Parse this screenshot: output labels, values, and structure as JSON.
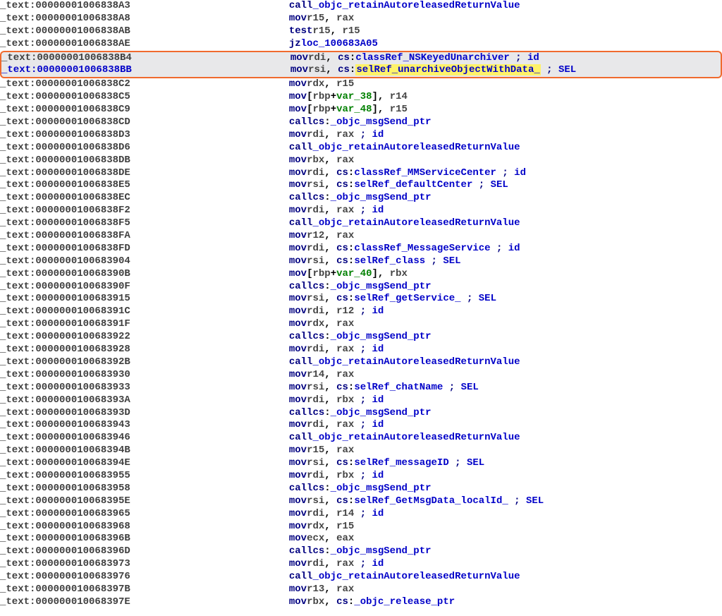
{
  "rows": [
    {
      "addr": "_text:00000001006838A3",
      "mnem": "call",
      "ops": [
        {
          "t": "id",
          "v": "_objc_retainAutoreleasedReturnValue"
        }
      ]
    },
    {
      "addr": "_text:00000001006838A8",
      "mnem": "mov",
      "ops": [
        {
          "t": "reg",
          "v": "r15"
        },
        {
          "t": "comma"
        },
        {
          "t": "reg",
          "v": "rax"
        }
      ]
    },
    {
      "addr": "_text:00000001006838AB",
      "mnem": "test",
      "ops": [
        {
          "t": "reg",
          "v": "r15"
        },
        {
          "t": "comma"
        },
        {
          "t": "reg",
          "v": "r15"
        }
      ]
    },
    {
      "addr": "_text:00000001006838AE",
      "mnem": "jz",
      "ops": [
        {
          "t": "id",
          "v": "loc_100683A05"
        }
      ]
    },
    {
      "addr": "_text:00000001006838B4",
      "mnem": "mov",
      "boxed": "top",
      "ops": [
        {
          "t": "reg",
          "v": "rdi"
        },
        {
          "t": "comma"
        },
        {
          "t": "kw",
          "v": "cs"
        },
        {
          "t": "txt",
          "v": ":"
        },
        {
          "t": "id",
          "v": "classRef_NSKeyedUnarchiver"
        },
        {
          "t": "sp"
        },
        {
          "t": "kw",
          "v": ";"
        },
        {
          "t": "sp"
        },
        {
          "t": "id",
          "v": "id"
        }
      ]
    },
    {
      "addr": "_text:00000001006838BB",
      "mnem": "mov",
      "current": true,
      "boxed": "bot",
      "ops": [
        {
          "t": "reg",
          "v": "rsi"
        },
        {
          "t": "comma"
        },
        {
          "t": "kw",
          "v": "cs"
        },
        {
          "t": "txt",
          "v": ":"
        },
        {
          "t": "hl",
          "v": "selRef_unarchiveObjectWithData_"
        },
        {
          "t": "sp"
        },
        {
          "t": "sp"
        },
        {
          "t": "kw",
          "v": ";"
        },
        {
          "t": "sp"
        },
        {
          "t": "id",
          "v": "SEL"
        }
      ]
    },
    {
      "addr": "_text:00000001006838C2",
      "mnem": "mov",
      "ops": [
        {
          "t": "reg",
          "v": "rdx"
        },
        {
          "t": "comma"
        },
        {
          "t": "reg",
          "v": "r15"
        }
      ]
    },
    {
      "addr": "_text:00000001006838C5",
      "mnem": "mov",
      "ops": [
        {
          "t": "txt",
          "v": "["
        },
        {
          "t": "reg",
          "v": "rbp"
        },
        {
          "t": "txt",
          "v": "+"
        },
        {
          "t": "var",
          "v": "var_38"
        },
        {
          "t": "txt",
          "v": "]"
        },
        {
          "t": "comma"
        },
        {
          "t": "reg",
          "v": "r14"
        }
      ]
    },
    {
      "addr": "_text:00000001006838C9",
      "mnem": "mov",
      "ops": [
        {
          "t": "txt",
          "v": "["
        },
        {
          "t": "reg",
          "v": "rbp"
        },
        {
          "t": "txt",
          "v": "+"
        },
        {
          "t": "var",
          "v": "var_48"
        },
        {
          "t": "txt",
          "v": "]"
        },
        {
          "t": "comma"
        },
        {
          "t": "reg",
          "v": "r15"
        }
      ]
    },
    {
      "addr": "_text:00000001006838CD",
      "mnem": "call",
      "ops": [
        {
          "t": "kw",
          "v": "cs"
        },
        {
          "t": "txt",
          "v": ":"
        },
        {
          "t": "id",
          "v": "_objc_msgSend_ptr"
        }
      ]
    },
    {
      "addr": "_text:00000001006838D3",
      "mnem": "mov",
      "ops": [
        {
          "t": "reg",
          "v": "rdi"
        },
        {
          "t": "comma"
        },
        {
          "t": "reg",
          "v": "rax"
        },
        {
          "t": "pad"
        },
        {
          "t": "kw",
          "v": ";"
        },
        {
          "t": "sp"
        },
        {
          "t": "id",
          "v": "id"
        }
      ]
    },
    {
      "addr": "_text:00000001006838D6",
      "mnem": "call",
      "ops": [
        {
          "t": "id",
          "v": "_objc_retainAutoreleasedReturnValue"
        }
      ]
    },
    {
      "addr": "_text:00000001006838DB",
      "mnem": "mov",
      "ops": [
        {
          "t": "reg",
          "v": "rbx"
        },
        {
          "t": "comma"
        },
        {
          "t": "reg",
          "v": "rax"
        }
      ]
    },
    {
      "addr": "_text:00000001006838DE",
      "mnem": "mov",
      "ops": [
        {
          "t": "reg",
          "v": "rdi"
        },
        {
          "t": "comma"
        },
        {
          "t": "kw",
          "v": "cs"
        },
        {
          "t": "txt",
          "v": ":"
        },
        {
          "t": "id",
          "v": "classRef_MMServiceCenter"
        },
        {
          "t": "sp"
        },
        {
          "t": "kw",
          "v": ";"
        },
        {
          "t": "sp"
        },
        {
          "t": "id",
          "v": "id"
        }
      ]
    },
    {
      "addr": "_text:00000001006838E5",
      "mnem": "mov",
      "ops": [
        {
          "t": "reg",
          "v": "rsi"
        },
        {
          "t": "comma"
        },
        {
          "t": "kw",
          "v": "cs"
        },
        {
          "t": "txt",
          "v": ":"
        },
        {
          "t": "id",
          "v": "selRef_defaultCenter"
        },
        {
          "t": "sp"
        },
        {
          "t": "kw",
          "v": ";"
        },
        {
          "t": "sp"
        },
        {
          "t": "id",
          "v": "SEL"
        }
      ]
    },
    {
      "addr": "_text:00000001006838EC",
      "mnem": "call",
      "ops": [
        {
          "t": "kw",
          "v": "cs"
        },
        {
          "t": "txt",
          "v": ":"
        },
        {
          "t": "id",
          "v": "_objc_msgSend_ptr"
        }
      ]
    },
    {
      "addr": "_text:00000001006838F2",
      "mnem": "mov",
      "ops": [
        {
          "t": "reg",
          "v": "rdi"
        },
        {
          "t": "comma"
        },
        {
          "t": "reg",
          "v": "rax"
        },
        {
          "t": "pad"
        },
        {
          "t": "kw",
          "v": ";"
        },
        {
          "t": "sp"
        },
        {
          "t": "id",
          "v": "id"
        }
      ]
    },
    {
      "addr": "_text:00000001006838F5",
      "mnem": "call",
      "ops": [
        {
          "t": "id",
          "v": "_objc_retainAutoreleasedReturnValue"
        }
      ]
    },
    {
      "addr": "_text:00000001006838FA",
      "mnem": "mov",
      "ops": [
        {
          "t": "reg",
          "v": "r12"
        },
        {
          "t": "comma"
        },
        {
          "t": "reg",
          "v": "rax"
        }
      ]
    },
    {
      "addr": "_text:00000001006838FD",
      "mnem": "mov",
      "ops": [
        {
          "t": "reg",
          "v": "rdi"
        },
        {
          "t": "comma"
        },
        {
          "t": "kw",
          "v": "cs"
        },
        {
          "t": "txt",
          "v": ":"
        },
        {
          "t": "id",
          "v": "classRef_MessageService"
        },
        {
          "t": "sp"
        },
        {
          "t": "kw",
          "v": ";"
        },
        {
          "t": "sp"
        },
        {
          "t": "id",
          "v": "id"
        }
      ]
    },
    {
      "addr": "_text:0000000100683904",
      "mnem": "mov",
      "ops": [
        {
          "t": "reg",
          "v": "rsi"
        },
        {
          "t": "comma"
        },
        {
          "t": "kw",
          "v": "cs"
        },
        {
          "t": "txt",
          "v": ":"
        },
        {
          "t": "id",
          "v": "selRef_class"
        },
        {
          "t": "sp"
        },
        {
          "t": "kw",
          "v": ";"
        },
        {
          "t": "sp"
        },
        {
          "t": "id",
          "v": "SEL"
        }
      ]
    },
    {
      "addr": "_text:000000010068390B",
      "mnem": "mov",
      "ops": [
        {
          "t": "txt",
          "v": "["
        },
        {
          "t": "reg",
          "v": "rbp"
        },
        {
          "t": "txt",
          "v": "+"
        },
        {
          "t": "var",
          "v": "var_40"
        },
        {
          "t": "txt",
          "v": "]"
        },
        {
          "t": "comma"
        },
        {
          "t": "reg",
          "v": "rbx"
        }
      ]
    },
    {
      "addr": "_text:000000010068390F",
      "mnem": "call",
      "ops": [
        {
          "t": "kw",
          "v": "cs"
        },
        {
          "t": "txt",
          "v": ":"
        },
        {
          "t": "id",
          "v": "_objc_msgSend_ptr"
        }
      ]
    },
    {
      "addr": "_text:0000000100683915",
      "mnem": "mov",
      "ops": [
        {
          "t": "reg",
          "v": "rsi"
        },
        {
          "t": "comma"
        },
        {
          "t": "kw",
          "v": "cs"
        },
        {
          "t": "txt",
          "v": ":"
        },
        {
          "t": "id",
          "v": "selRef_getService_"
        },
        {
          "t": "sp"
        },
        {
          "t": "kw",
          "v": ";"
        },
        {
          "t": "sp"
        },
        {
          "t": "id",
          "v": "SEL"
        }
      ]
    },
    {
      "addr": "_text:000000010068391C",
      "mnem": "mov",
      "ops": [
        {
          "t": "reg",
          "v": "rdi"
        },
        {
          "t": "comma"
        },
        {
          "t": "reg",
          "v": "r12"
        },
        {
          "t": "pad"
        },
        {
          "t": "kw",
          "v": ";"
        },
        {
          "t": "sp"
        },
        {
          "t": "id",
          "v": "id"
        }
      ]
    },
    {
      "addr": "_text:000000010068391F",
      "mnem": "mov",
      "ops": [
        {
          "t": "reg",
          "v": "rdx"
        },
        {
          "t": "comma"
        },
        {
          "t": "reg",
          "v": "rax"
        }
      ]
    },
    {
      "addr": "_text:0000000100683922",
      "mnem": "call",
      "ops": [
        {
          "t": "kw",
          "v": "cs"
        },
        {
          "t": "txt",
          "v": ":"
        },
        {
          "t": "id",
          "v": "_objc_msgSend_ptr"
        }
      ]
    },
    {
      "addr": "_text:0000000100683928",
      "mnem": "mov",
      "ops": [
        {
          "t": "reg",
          "v": "rdi"
        },
        {
          "t": "comma"
        },
        {
          "t": "reg",
          "v": "rax"
        },
        {
          "t": "pad"
        },
        {
          "t": "kw",
          "v": ";"
        },
        {
          "t": "sp"
        },
        {
          "t": "id",
          "v": "id"
        }
      ]
    },
    {
      "addr": "_text:000000010068392B",
      "mnem": "call",
      "ops": [
        {
          "t": "id",
          "v": "_objc_retainAutoreleasedReturnValue"
        }
      ]
    },
    {
      "addr": "_text:0000000100683930",
      "mnem": "mov",
      "ops": [
        {
          "t": "reg",
          "v": "r14"
        },
        {
          "t": "comma"
        },
        {
          "t": "reg",
          "v": "rax"
        }
      ]
    },
    {
      "addr": "_text:0000000100683933",
      "mnem": "mov",
      "ops": [
        {
          "t": "reg",
          "v": "rsi"
        },
        {
          "t": "comma"
        },
        {
          "t": "kw",
          "v": "cs"
        },
        {
          "t": "txt",
          "v": ":"
        },
        {
          "t": "id",
          "v": "selRef_chatName"
        },
        {
          "t": "sp"
        },
        {
          "t": "kw",
          "v": ";"
        },
        {
          "t": "sp"
        },
        {
          "t": "id",
          "v": "SEL"
        }
      ]
    },
    {
      "addr": "_text:000000010068393A",
      "mnem": "mov",
      "ops": [
        {
          "t": "reg",
          "v": "rdi"
        },
        {
          "t": "comma"
        },
        {
          "t": "reg",
          "v": "rbx"
        },
        {
          "t": "pad"
        },
        {
          "t": "kw",
          "v": ";"
        },
        {
          "t": "sp"
        },
        {
          "t": "id",
          "v": "id"
        }
      ]
    },
    {
      "addr": "_text:000000010068393D",
      "mnem": "call",
      "ops": [
        {
          "t": "kw",
          "v": "cs"
        },
        {
          "t": "txt",
          "v": ":"
        },
        {
          "t": "id",
          "v": "_objc_msgSend_ptr"
        }
      ]
    },
    {
      "addr": "_text:0000000100683943",
      "mnem": "mov",
      "ops": [
        {
          "t": "reg",
          "v": "rdi"
        },
        {
          "t": "comma"
        },
        {
          "t": "reg",
          "v": "rax"
        },
        {
          "t": "pad"
        },
        {
          "t": "kw",
          "v": ";"
        },
        {
          "t": "sp"
        },
        {
          "t": "id",
          "v": "id"
        }
      ]
    },
    {
      "addr": "_text:0000000100683946",
      "mnem": "call",
      "ops": [
        {
          "t": "id",
          "v": "_objc_retainAutoreleasedReturnValue"
        }
      ]
    },
    {
      "addr": "_text:000000010068394B",
      "mnem": "mov",
      "ops": [
        {
          "t": "reg",
          "v": "r15"
        },
        {
          "t": "comma"
        },
        {
          "t": "reg",
          "v": "rax"
        }
      ]
    },
    {
      "addr": "_text:000000010068394E",
      "mnem": "mov",
      "ops": [
        {
          "t": "reg",
          "v": "rsi"
        },
        {
          "t": "comma"
        },
        {
          "t": "kw",
          "v": "cs"
        },
        {
          "t": "txt",
          "v": ":"
        },
        {
          "t": "id",
          "v": "selRef_messageID"
        },
        {
          "t": "sp"
        },
        {
          "t": "kw",
          "v": ";"
        },
        {
          "t": "sp"
        },
        {
          "t": "id",
          "v": "SEL"
        }
      ]
    },
    {
      "addr": "_text:0000000100683955",
      "mnem": "mov",
      "ops": [
        {
          "t": "reg",
          "v": "rdi"
        },
        {
          "t": "comma"
        },
        {
          "t": "reg",
          "v": "rbx"
        },
        {
          "t": "pad"
        },
        {
          "t": "kw",
          "v": ";"
        },
        {
          "t": "sp"
        },
        {
          "t": "id",
          "v": "id"
        }
      ]
    },
    {
      "addr": "_text:0000000100683958",
      "mnem": "call",
      "ops": [
        {
          "t": "kw",
          "v": "cs"
        },
        {
          "t": "txt",
          "v": ":"
        },
        {
          "t": "id",
          "v": "_objc_msgSend_ptr"
        }
      ]
    },
    {
      "addr": "_text:000000010068395E",
      "mnem": "mov",
      "ops": [
        {
          "t": "reg",
          "v": "rsi"
        },
        {
          "t": "comma"
        },
        {
          "t": "kw",
          "v": "cs"
        },
        {
          "t": "txt",
          "v": ":"
        },
        {
          "t": "id",
          "v": "selRef_GetMsgData_localId_"
        },
        {
          "t": "sp"
        },
        {
          "t": "kw",
          "v": ";"
        },
        {
          "t": "sp"
        },
        {
          "t": "id",
          "v": "SEL"
        }
      ]
    },
    {
      "addr": "_text:0000000100683965",
      "mnem": "mov",
      "ops": [
        {
          "t": "reg",
          "v": "rdi"
        },
        {
          "t": "comma"
        },
        {
          "t": "reg",
          "v": "r14"
        },
        {
          "t": "pad"
        },
        {
          "t": "kw",
          "v": ";"
        },
        {
          "t": "sp"
        },
        {
          "t": "id",
          "v": "id"
        }
      ]
    },
    {
      "addr": "_text:0000000100683968",
      "mnem": "mov",
      "ops": [
        {
          "t": "reg",
          "v": "rdx"
        },
        {
          "t": "comma"
        },
        {
          "t": "reg",
          "v": "r15"
        }
      ]
    },
    {
      "addr": "_text:000000010068396B",
      "mnem": "mov",
      "ops": [
        {
          "t": "reg",
          "v": "ecx"
        },
        {
          "t": "comma"
        },
        {
          "t": "reg",
          "v": "eax"
        }
      ]
    },
    {
      "addr": "_text:000000010068396D",
      "mnem": "call",
      "ops": [
        {
          "t": "kw",
          "v": "cs"
        },
        {
          "t": "txt",
          "v": ":"
        },
        {
          "t": "id",
          "v": "_objc_msgSend_ptr"
        }
      ]
    },
    {
      "addr": "_text:0000000100683973",
      "mnem": "mov",
      "ops": [
        {
          "t": "reg",
          "v": "rdi"
        },
        {
          "t": "comma"
        },
        {
          "t": "reg",
          "v": "rax"
        },
        {
          "t": "pad"
        },
        {
          "t": "kw",
          "v": ";"
        },
        {
          "t": "sp"
        },
        {
          "t": "id",
          "v": "id"
        }
      ]
    },
    {
      "addr": "_text:0000000100683976",
      "mnem": "call",
      "ops": [
        {
          "t": "id",
          "v": "_objc_retainAutoreleasedReturnValue"
        }
      ]
    },
    {
      "addr": "_text:000000010068397B",
      "mnem": "mov",
      "ops": [
        {
          "t": "reg",
          "v": "r13"
        },
        {
          "t": "comma"
        },
        {
          "t": "reg",
          "v": "rax"
        }
      ]
    },
    {
      "addr": "_text:000000010068397E",
      "mnem": "mov",
      "ops": [
        {
          "t": "reg",
          "v": "rbx"
        },
        {
          "t": "comma"
        },
        {
          "t": "kw",
          "v": "cs"
        },
        {
          "t": "txt",
          "v": ":"
        },
        {
          "t": "id",
          "v": "_objc_release_ptr"
        }
      ]
    }
  ]
}
